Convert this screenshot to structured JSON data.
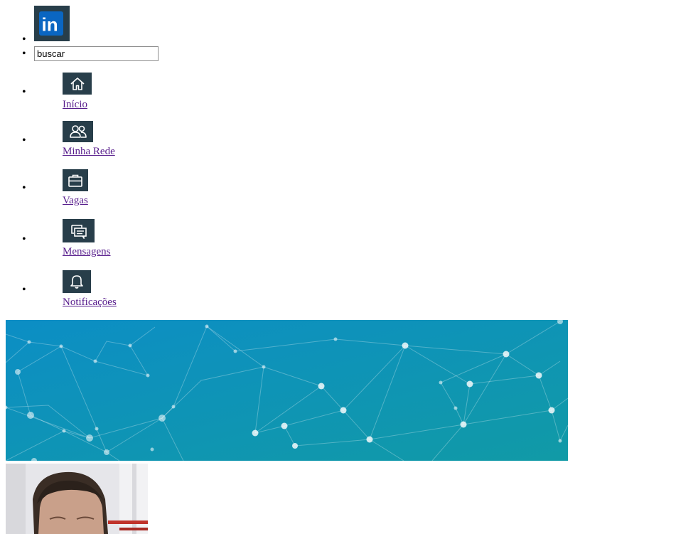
{
  "logo": {
    "icon": "linkedin-logo-icon",
    "text": "in",
    "color": "#0a66c2"
  },
  "search": {
    "value": "buscar"
  },
  "nav": {
    "items": [
      {
        "label": "Início",
        "icon": "home-icon"
      },
      {
        "label": "Minha Rede",
        "icon": "people-icon"
      },
      {
        "label": "Vagas",
        "icon": "briefcase-icon"
      },
      {
        "label": "Mensagens",
        "icon": "messages-icon"
      },
      {
        "label": "Notificações",
        "icon": "bell-icon"
      }
    ],
    "icon_bg": "#283e4a",
    "link_color": "#551a8b"
  },
  "banner": {
    "image": "network-background",
    "colors": [
      "#0c8ec5",
      "#119aa6"
    ]
  },
  "profile": {
    "image": "profile-photo"
  }
}
